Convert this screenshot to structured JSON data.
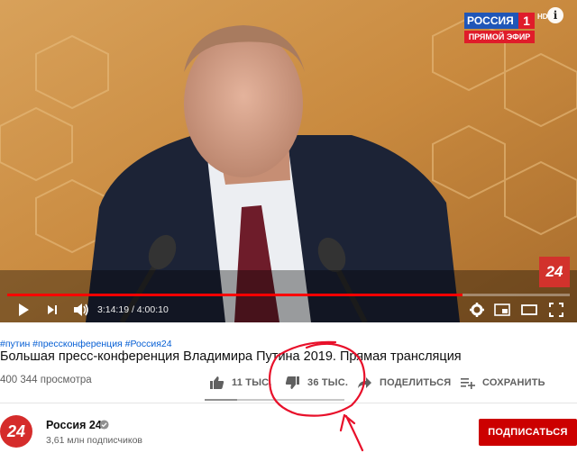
{
  "player": {
    "channel_logo_top": "РОССИЯ",
    "channel_logo_number": "1",
    "channel_logo_bottom": "ПРЯМОЙ ЭФИР",
    "hd_label": "HD",
    "corner_badge": "24",
    "time_current": "3:14:19",
    "time_total": "4:00:10",
    "time_display": "3:14:19 / 4:00:10",
    "progress": 0.81,
    "accent_color": "#ff0000"
  },
  "video": {
    "hashtags": "#путин #прессконференция #Россия24",
    "title": "Большая пресс-конференция Владимира Путина 2019. Прямая трансляция",
    "views": "400 344 просмотра"
  },
  "actions": {
    "like_count": "11 ТЫС.",
    "dislike_count": "36 ТЫС.",
    "share_label": "ПОДЕЛИТЬСЯ",
    "save_label": "СОХРАНИТЬ",
    "like_ratio": 0.23
  },
  "channel": {
    "avatar_text": "24",
    "name": "Россия 24",
    "subscribers": "3,61 млн подписчиков",
    "subscribe_label": "ПОДПИСАТЬСЯ",
    "subscribe_color": "#cc0000"
  },
  "annotation": {
    "color": "#e8102a"
  }
}
